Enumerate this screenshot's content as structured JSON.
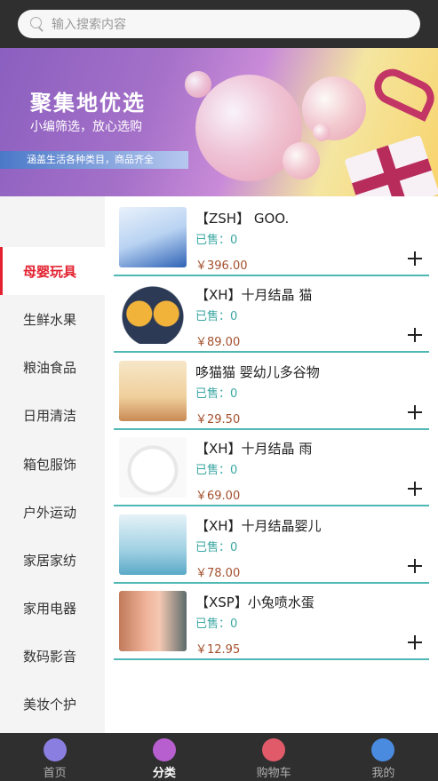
{
  "search": {
    "placeholder": "输入搜索内容"
  },
  "banner": {
    "title": "聚集地优选",
    "subtitle": "小编筛选，放心选购",
    "tag": "涵盖生活各种类目，商品齐全"
  },
  "sidebar": {
    "active_index": 0,
    "items": [
      {
        "label": "母婴玩具"
      },
      {
        "label": "生鲜水果"
      },
      {
        "label": "粮油食品"
      },
      {
        "label": "日用清洁"
      },
      {
        "label": "箱包服饰"
      },
      {
        "label": "户外运动"
      },
      {
        "label": "家居家纺"
      },
      {
        "label": "家用电器"
      },
      {
        "label": "数码影音"
      },
      {
        "label": "美妆个护"
      }
    ]
  },
  "products": [
    {
      "name": "【ZSH】 GOO.",
      "sold": "已售：0",
      "price": "￥396.00",
      "image": "diaper-pack"
    },
    {
      "name": "【XH】十月结晶 猫",
      "sold": "已售：0",
      "price": "￥89.00",
      "image": "owl-plate"
    },
    {
      "name": "哆猫猫 婴幼儿多谷物",
      "sold": "已售：0",
      "price": "￥29.50",
      "image": "cereal"
    },
    {
      "name": "【XH】十月结晶 雨",
      "sold": "已售：0",
      "price": "￥69.00",
      "image": "cream-jar"
    },
    {
      "name": "【XH】十月结晶婴儿",
      "sold": "已售：0",
      "price": "￥78.00",
      "image": "lotion-bottle"
    },
    {
      "name": "【XSP】小兔喷水蛋",
      "sold": "已售：0",
      "price": "￥12.95",
      "image": "bath-toy"
    }
  ],
  "tabbar": {
    "active_index": 1,
    "tabs": [
      {
        "label": "首页",
        "icon": "home-icon"
      },
      {
        "label": "分类",
        "icon": "category-icon"
      },
      {
        "label": "购物车",
        "icon": "cart-icon"
      },
      {
        "label": "我的",
        "icon": "profile-icon"
      }
    ]
  },
  "colors": {
    "accent_red": "#e3212f",
    "teal": "#4fb8b4",
    "price": "#a3502e",
    "bar_bg": "#2f2f2f"
  }
}
